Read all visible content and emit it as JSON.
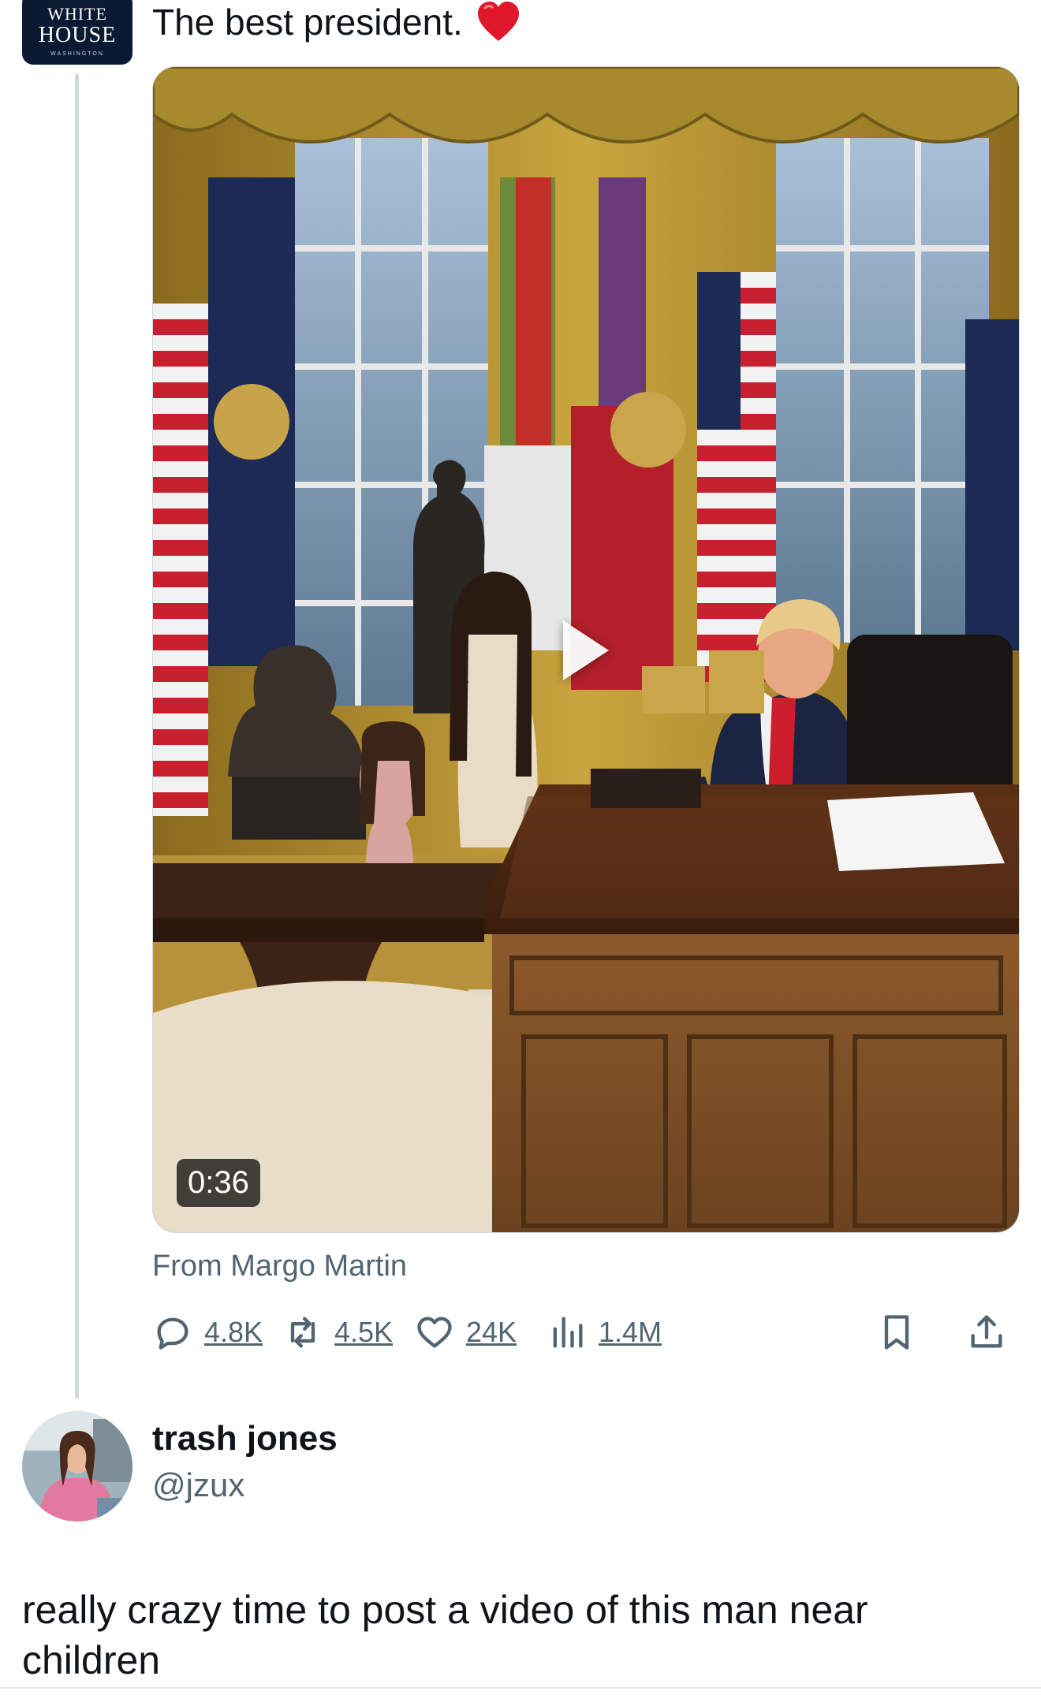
{
  "post": {
    "avatar": {
      "line1": "WHITE",
      "line2": "HOUSE",
      "line3": "WASHINGTON"
    },
    "text": "The best president.",
    "emoji": "heart-emoji",
    "video": {
      "duration": "0:36"
    },
    "attribution": "From Margo Martin",
    "metrics": {
      "replies": "4.8K",
      "reposts": "4.5K",
      "likes": "24K",
      "views": "1.4M"
    }
  },
  "reply": {
    "name": "trash jones",
    "handle": "@jzux",
    "text": "really crazy time to post a video of this man near children"
  },
  "colors": {
    "text": "#0f1419",
    "secondary": "#536471",
    "thread_line": "#cfd9de",
    "wh_avatar_bg": "#0b1a33",
    "heart": "#e0162b"
  }
}
